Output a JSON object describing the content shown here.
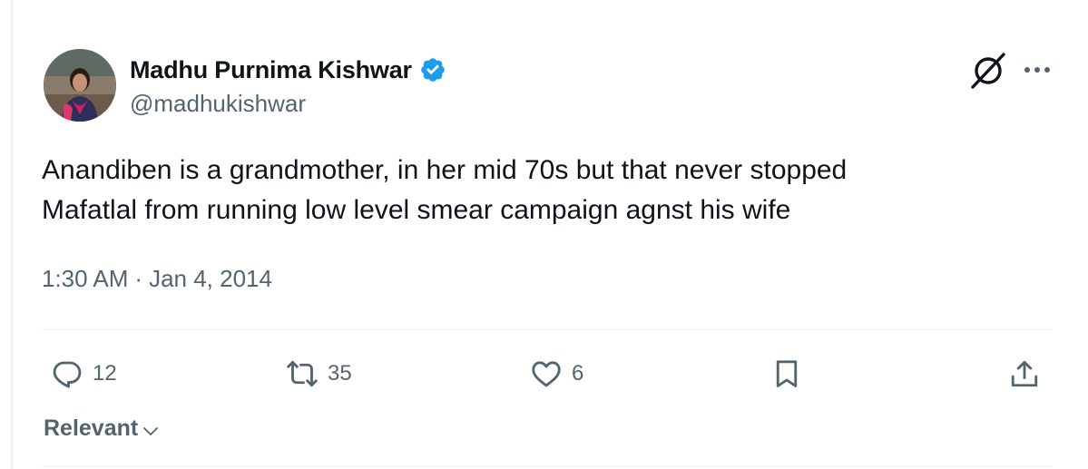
{
  "author": {
    "display_name": "Madhu Purnima Kishwar",
    "handle": "@madhukishwar",
    "verified": true,
    "verified_color": "#1d9bf0"
  },
  "tweet": {
    "lines": [
      "Anandiben is a grandmother, in her mid 70s but that never stopped",
      "Mafatlal from running low level smear campaign agnst his wife"
    ],
    "time": "1:30 AM",
    "separator": "·",
    "date": "Jan 4, 2014"
  },
  "actions": {
    "reply": {
      "icon": "reply-icon",
      "count": "12"
    },
    "retweet": {
      "icon": "retweet-icon",
      "count": "35"
    },
    "like": {
      "icon": "heart-icon",
      "count": "6"
    },
    "bookmark": {
      "icon": "bookmark-icon"
    },
    "share": {
      "icon": "share-icon"
    }
  },
  "sort": {
    "label": "Relevant",
    "icon": "chevron-down-icon"
  },
  "colors": {
    "text_primary": "#0f1419",
    "text_secondary": "#536471",
    "divider": "#eff3f4"
  }
}
